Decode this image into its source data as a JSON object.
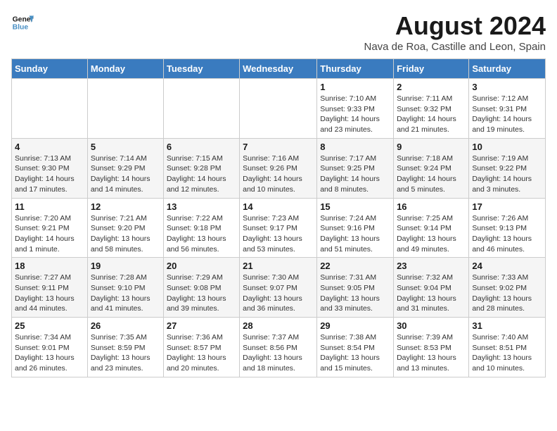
{
  "logo": {
    "line1": "General",
    "line2": "Blue"
  },
  "title": "August 2024",
  "subtitle": "Nava de Roa, Castille and Leon, Spain",
  "weekdays": [
    "Sunday",
    "Monday",
    "Tuesday",
    "Wednesday",
    "Thursday",
    "Friday",
    "Saturday"
  ],
  "weeks": [
    [
      {
        "day": "",
        "info": ""
      },
      {
        "day": "",
        "info": ""
      },
      {
        "day": "",
        "info": ""
      },
      {
        "day": "",
        "info": ""
      },
      {
        "day": "1",
        "info": "Sunrise: 7:10 AM\nSunset: 9:33 PM\nDaylight: 14 hours and 23 minutes."
      },
      {
        "day": "2",
        "info": "Sunrise: 7:11 AM\nSunset: 9:32 PM\nDaylight: 14 hours and 21 minutes."
      },
      {
        "day": "3",
        "info": "Sunrise: 7:12 AM\nSunset: 9:31 PM\nDaylight: 14 hours and 19 minutes."
      }
    ],
    [
      {
        "day": "4",
        "info": "Sunrise: 7:13 AM\nSunset: 9:30 PM\nDaylight: 14 hours and 17 minutes."
      },
      {
        "day": "5",
        "info": "Sunrise: 7:14 AM\nSunset: 9:29 PM\nDaylight: 14 hours and 14 minutes."
      },
      {
        "day": "6",
        "info": "Sunrise: 7:15 AM\nSunset: 9:28 PM\nDaylight: 14 hours and 12 minutes."
      },
      {
        "day": "7",
        "info": "Sunrise: 7:16 AM\nSunset: 9:26 PM\nDaylight: 14 hours and 10 minutes."
      },
      {
        "day": "8",
        "info": "Sunrise: 7:17 AM\nSunset: 9:25 PM\nDaylight: 14 hours and 8 minutes."
      },
      {
        "day": "9",
        "info": "Sunrise: 7:18 AM\nSunset: 9:24 PM\nDaylight: 14 hours and 5 minutes."
      },
      {
        "day": "10",
        "info": "Sunrise: 7:19 AM\nSunset: 9:22 PM\nDaylight: 14 hours and 3 minutes."
      }
    ],
    [
      {
        "day": "11",
        "info": "Sunrise: 7:20 AM\nSunset: 9:21 PM\nDaylight: 14 hours and 1 minute."
      },
      {
        "day": "12",
        "info": "Sunrise: 7:21 AM\nSunset: 9:20 PM\nDaylight: 13 hours and 58 minutes."
      },
      {
        "day": "13",
        "info": "Sunrise: 7:22 AM\nSunset: 9:18 PM\nDaylight: 13 hours and 56 minutes."
      },
      {
        "day": "14",
        "info": "Sunrise: 7:23 AM\nSunset: 9:17 PM\nDaylight: 13 hours and 53 minutes."
      },
      {
        "day": "15",
        "info": "Sunrise: 7:24 AM\nSunset: 9:16 PM\nDaylight: 13 hours and 51 minutes."
      },
      {
        "day": "16",
        "info": "Sunrise: 7:25 AM\nSunset: 9:14 PM\nDaylight: 13 hours and 49 minutes."
      },
      {
        "day": "17",
        "info": "Sunrise: 7:26 AM\nSunset: 9:13 PM\nDaylight: 13 hours and 46 minutes."
      }
    ],
    [
      {
        "day": "18",
        "info": "Sunrise: 7:27 AM\nSunset: 9:11 PM\nDaylight: 13 hours and 44 minutes."
      },
      {
        "day": "19",
        "info": "Sunrise: 7:28 AM\nSunset: 9:10 PM\nDaylight: 13 hours and 41 minutes."
      },
      {
        "day": "20",
        "info": "Sunrise: 7:29 AM\nSunset: 9:08 PM\nDaylight: 13 hours and 39 minutes."
      },
      {
        "day": "21",
        "info": "Sunrise: 7:30 AM\nSunset: 9:07 PM\nDaylight: 13 hours and 36 minutes."
      },
      {
        "day": "22",
        "info": "Sunrise: 7:31 AM\nSunset: 9:05 PM\nDaylight: 13 hours and 33 minutes."
      },
      {
        "day": "23",
        "info": "Sunrise: 7:32 AM\nSunset: 9:04 PM\nDaylight: 13 hours and 31 minutes."
      },
      {
        "day": "24",
        "info": "Sunrise: 7:33 AM\nSunset: 9:02 PM\nDaylight: 13 hours and 28 minutes."
      }
    ],
    [
      {
        "day": "25",
        "info": "Sunrise: 7:34 AM\nSunset: 9:01 PM\nDaylight: 13 hours and 26 minutes."
      },
      {
        "day": "26",
        "info": "Sunrise: 7:35 AM\nSunset: 8:59 PM\nDaylight: 13 hours and 23 minutes."
      },
      {
        "day": "27",
        "info": "Sunrise: 7:36 AM\nSunset: 8:57 PM\nDaylight: 13 hours and 20 minutes."
      },
      {
        "day": "28",
        "info": "Sunrise: 7:37 AM\nSunset: 8:56 PM\nDaylight: 13 hours and 18 minutes."
      },
      {
        "day": "29",
        "info": "Sunrise: 7:38 AM\nSunset: 8:54 PM\nDaylight: 13 hours and 15 minutes."
      },
      {
        "day": "30",
        "info": "Sunrise: 7:39 AM\nSunset: 8:53 PM\nDaylight: 13 hours and 13 minutes."
      },
      {
        "day": "31",
        "info": "Sunrise: 7:40 AM\nSunset: 8:51 PM\nDaylight: 13 hours and 10 minutes."
      }
    ]
  ]
}
